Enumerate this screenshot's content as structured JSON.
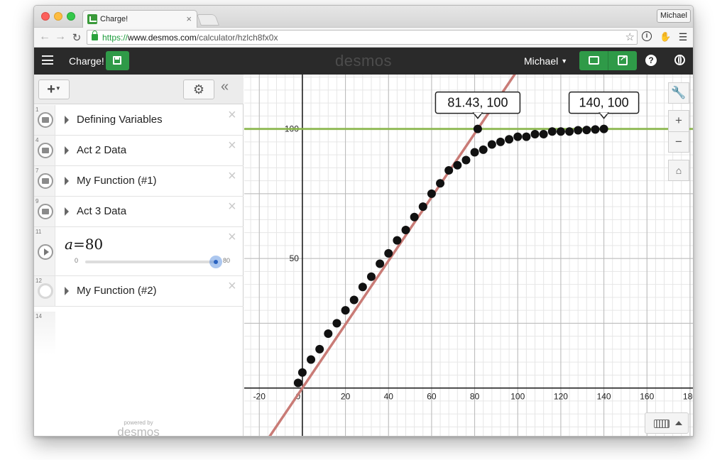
{
  "browser": {
    "tab_title": "Charge!",
    "tab_close": "×",
    "profile": "Michael",
    "url_scheme": "https://",
    "url_host": "www.desmos.com",
    "url_path": "/calculator/hzlch8fx0x"
  },
  "header": {
    "graph_title": "Charge!",
    "brand": "desmos",
    "user": "Michael"
  },
  "expressions": [
    {
      "num": "1",
      "type": "folder",
      "label": "Defining Variables"
    },
    {
      "num": "4",
      "type": "folder",
      "label": "Act 2 Data"
    },
    {
      "num": "7",
      "type": "folder",
      "label": "My Function (#1)"
    },
    {
      "num": "9",
      "type": "folder",
      "label": "Act 3 Data"
    },
    {
      "num": "11",
      "type": "slider",
      "variable": "a",
      "equals": "=",
      "value": "80",
      "min": "0",
      "max": "80"
    },
    {
      "num": "12",
      "type": "folder-hidden",
      "label": "My Function (#2)"
    },
    {
      "num": "14",
      "type": "empty"
    }
  ],
  "footer": {
    "powered_by": "powered by",
    "brand": "desmos"
  },
  "graph_controls": {
    "wrench": "wrench-icon",
    "zoom_in": "+",
    "zoom_out": "−",
    "home": "home-icon"
  },
  "chart_data": {
    "type": "scatter",
    "x_range": [
      -27,
      182
    ],
    "y_range": [
      -19,
      121
    ],
    "x_ticks": [
      "-20",
      "0",
      "20",
      "40",
      "60",
      "80",
      "100",
      "120",
      "140",
      "160",
      "180"
    ],
    "x_tick_values": [
      -20,
      0,
      20,
      40,
      60,
      80,
      100,
      120,
      140,
      160,
      180
    ],
    "y_ticks": [
      "50",
      "100"
    ],
    "y_tick_values": [
      50,
      100
    ],
    "grid": true,
    "colors": {
      "line": "#c97b76",
      "horizontal": "#8ab84a",
      "points": "#111111",
      "major_grid": "#b9b9b9",
      "minor_grid": "#e6e6e6"
    },
    "line": {
      "slope": 1.228,
      "intercept": 0
    },
    "horizontal_y": 100,
    "points": [
      [
        -2,
        2
      ],
      [
        0,
        6
      ],
      [
        4,
        11
      ],
      [
        8,
        15
      ],
      [
        12,
        21
      ],
      [
        16,
        25
      ],
      [
        20,
        30
      ],
      [
        24,
        34
      ],
      [
        28,
        39
      ],
      [
        32,
        43
      ],
      [
        36,
        48
      ],
      [
        40,
        52
      ],
      [
        44,
        57
      ],
      [
        48,
        61
      ],
      [
        52,
        66
      ],
      [
        56,
        70
      ],
      [
        60,
        75
      ],
      [
        64,
        79
      ],
      [
        68,
        84
      ],
      [
        72,
        86
      ],
      [
        76,
        88
      ],
      [
        80,
        91
      ],
      [
        84,
        92
      ],
      [
        88,
        94
      ],
      [
        92,
        95
      ],
      [
        96,
        96
      ],
      [
        100,
        97
      ],
      [
        104,
        97
      ],
      [
        108,
        98
      ],
      [
        112,
        98
      ],
      [
        116,
        99
      ],
      [
        120,
        99
      ],
      [
        124,
        99
      ],
      [
        128,
        99.5
      ],
      [
        132,
        99.6
      ],
      [
        136,
        99.8
      ],
      [
        140,
        100
      ],
      [
        81.43,
        100
      ]
    ],
    "labels": [
      {
        "text": "81.43, 100",
        "x": 81.43,
        "y": 100
      },
      {
        "text": "140, 100",
        "x": 140,
        "y": 100
      }
    ]
  }
}
